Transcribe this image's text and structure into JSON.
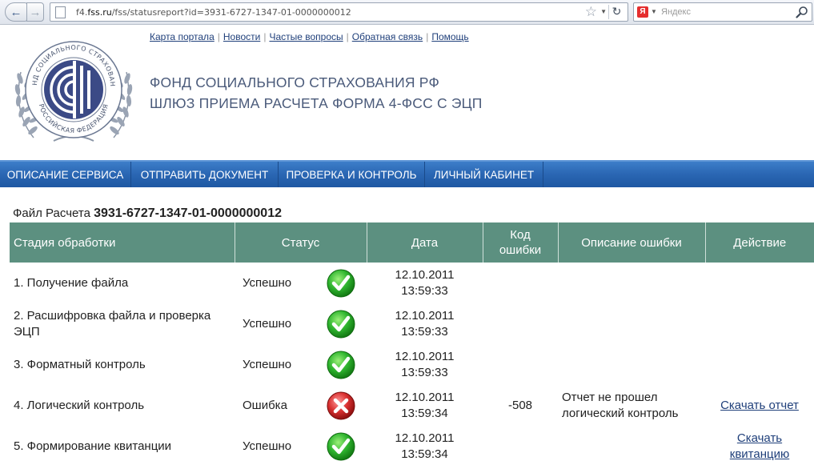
{
  "browser": {
    "url_prefix": "f4.",
    "url_domain": "fss.ru",
    "url_path": "/fss/statusreport?id=3931-6727-1347-01-0000000012",
    "search_placeholder": "Яндекс",
    "search_engine_letter": "Я"
  },
  "header": {
    "links": [
      "Карта портала",
      "Новости",
      "Частые вопросы",
      "Обратная связь",
      "Помощь"
    ],
    "title_line1": "ФОНД СОЦИАЛЬНОГО СТРАХОВАНИЯ РФ",
    "title_line2": "ШЛЮЗ ПРИЕМА РАСЧЕТА ФОРМА 4-ФСС С ЭЦП",
    "emblem_text_top": "ФОНД СОЦИАЛЬНОГО СТРАХОВАНИЯ",
    "emblem_text_bottom": "РОССИЙСКАЯ ФЕДЕРАЦИЯ"
  },
  "nav": {
    "items": [
      "ОПИСАНИЕ СЕРВИСА",
      "ОТПРАВИТЬ ДОКУМЕНТ",
      "ПРОВЕРКА И КОНТРОЛЬ",
      "ЛИЧНЫЙ КАБИНЕТ"
    ]
  },
  "report": {
    "file_label": "Файл Расчета",
    "file_id": "3931-6727-1347-01-0000000012",
    "columns": {
      "stage": "Стадия обработки",
      "status": "Статус",
      "date": "Дата",
      "code_line1": "Код",
      "code_line2": "ошибки",
      "desc": "Описание ошибки",
      "action": "Действие"
    },
    "rows": [
      {
        "stage": "1. Получение файла",
        "status": "Успешно",
        "icon": "success-check-icon",
        "date": "12.10.2011",
        "time": "13:59:33",
        "code": "",
        "desc_line1": "",
        "desc_line2": "",
        "action_line1": "",
        "action_line2": ""
      },
      {
        "stage": "2. Расшифровка файла и проверка ЭЦП",
        "status": "Успешно",
        "icon": "success-check-icon",
        "date": "12.10.2011",
        "time": "13:59:33",
        "code": "",
        "desc_line1": "",
        "desc_line2": "",
        "action_line1": "",
        "action_line2": ""
      },
      {
        "stage": "3. Форматный контроль",
        "status": "Успешно",
        "icon": "success-check-icon",
        "date": "12.10.2011",
        "time": "13:59:33",
        "code": "",
        "desc_line1": "",
        "desc_line2": "",
        "action_line1": "",
        "action_line2": ""
      },
      {
        "stage": "4. Логический контроль",
        "status": "Ошибка",
        "icon": "error-cross-icon",
        "date": "12.10.2011",
        "time": "13:59:34",
        "code": "-508",
        "desc_line1": "Отчет не прошел",
        "desc_line2": "логический контроль",
        "action_line1": "Скачать отчет",
        "action_line2": ""
      },
      {
        "stage": "5. Формирование квитанции",
        "status": "Успешно",
        "icon": "success-check-icon",
        "date": "12.10.2011",
        "time": "13:59:34",
        "code": "",
        "desc_line1": "",
        "desc_line2": "",
        "action_line1": "Скачать",
        "action_line2": "квитанцию"
      }
    ]
  },
  "colors": {
    "nav_blue": "#2a66b3",
    "table_header": "#5c9080",
    "link": "#1f3f7a",
    "success_green": "#2fb52f",
    "error_red": "#d93030"
  }
}
